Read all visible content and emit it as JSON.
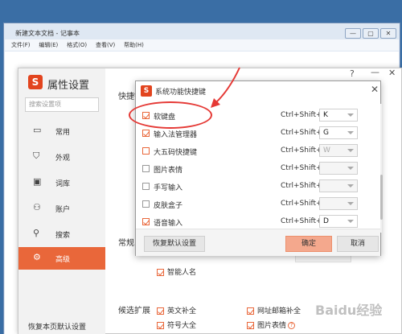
{
  "notepad": {
    "title": "新建文本文档 - 记事本",
    "menu": [
      "文件(F)",
      "编辑(E)",
      "格式(O)",
      "查看(V)",
      "帮助(H)"
    ],
    "controls": [
      "—",
      "▢",
      "✕"
    ]
  },
  "settings": {
    "logo_text": "S",
    "title": "属性设置",
    "search_placeholder": "搜索设置项",
    "nav": [
      {
        "icon": "monitor-icon",
        "glyph": "▭",
        "label": "常用"
      },
      {
        "icon": "shirt-icon",
        "glyph": "⛉",
        "label": "外观"
      },
      {
        "icon": "dictionary-icon",
        "glyph": "▣",
        "label": "词库"
      },
      {
        "icon": "user-icon",
        "glyph": "⚇",
        "label": "账户"
      },
      {
        "icon": "search-icon",
        "glyph": "⚲",
        "label": "搜索"
      },
      {
        "icon": "gear-icon",
        "glyph": "⚙",
        "label": "高级",
        "active": true
      }
    ],
    "restore_page": "恢复本页默认设置",
    "section_shortcut": "快捷键",
    "section_normal": "常规",
    "section_candidate": "候选扩展",
    "options": {
      "smart_name": "智能人名",
      "english_complete": "英文补全",
      "symbol_all": "符号大全",
      "web_email": "网址邮箱补全",
      "image_emoji": "图片表情"
    },
    "help_glyph": "?",
    "top_help": "?",
    "top_min": "—",
    "top_close": "✕"
  },
  "dialog": {
    "logo_text": "S",
    "title": "系统功能快捷键",
    "close": "✕",
    "rows": [
      {
        "label": "软键盘",
        "checked": true,
        "modifier": "Ctrl+Shift+",
        "key": "K",
        "enabled": true
      },
      {
        "label": "输入法管理器",
        "checked": true,
        "modifier": "Ctrl+Shift+",
        "key": "G",
        "enabled": true
      },
      {
        "label": "大五码快捷键",
        "checked": false,
        "orange": true,
        "modifier": "Ctrl+Shift+",
        "key": "W",
        "enabled": false
      },
      {
        "label": "图片表情",
        "checked": false,
        "modifier": "Ctrl+Shift+",
        "key": "",
        "enabled": false
      },
      {
        "label": "手写输入",
        "checked": false,
        "modifier": "Ctrl+Shift+",
        "key": "",
        "enabled": false
      },
      {
        "label": "皮肤盒子",
        "checked": false,
        "modifier": "Ctrl+Shift+",
        "key": "",
        "enabled": false
      },
      {
        "label": "语音输入",
        "checked": true,
        "modifier": "Ctrl+Shift+",
        "key": "D",
        "enabled": true
      }
    ],
    "restore_btn": "恢复默认设置",
    "ok_btn": "确定",
    "cancel_btn": "取消"
  },
  "watermark": "Baidu经验",
  "colors": {
    "accent": "#e9673a",
    "annotation": "#e53935"
  }
}
